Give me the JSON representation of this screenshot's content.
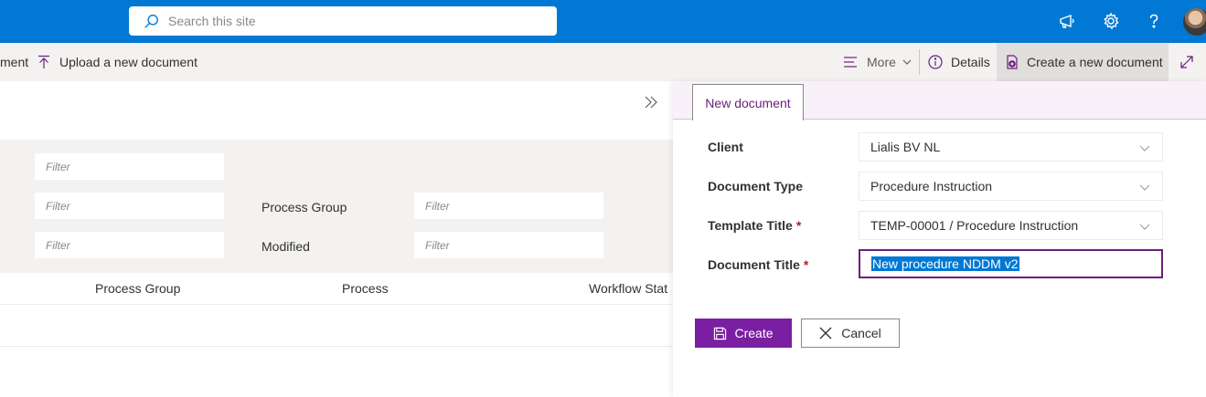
{
  "search": {
    "placeholder": "Search this site"
  },
  "suite_icons": [
    "megaphone-icon",
    "gear-icon",
    "help-icon"
  ],
  "commandbar": {
    "partial_left": "ment",
    "upload_label": "Upload a new document",
    "more_label": "More",
    "details_label": "Details",
    "create_label": "Create a new document"
  },
  "filters": {
    "placeholder": "Filter",
    "labels": [
      "Process Group",
      "Modified"
    ]
  },
  "grid": {
    "columns": [
      "Process Group",
      "Process",
      "Workflow Stat"
    ]
  },
  "panel": {
    "tab_label": "New document",
    "fields": [
      {
        "label": "Client",
        "value": "Lialis BV NL",
        "required": false
      },
      {
        "label": "Document Type",
        "value": "Procedure Instruction",
        "required": false
      },
      {
        "label": "Template Title",
        "value": "TEMP-00001 / Procedure Instruction",
        "required": true
      }
    ],
    "title_field": {
      "label": "Document Title",
      "value": "New procedure NDDM v2",
      "required": true
    },
    "required_mark": "*",
    "create_button": "Create",
    "cancel_button": "Cancel"
  },
  "colors": {
    "suitebar": "#0078d4",
    "accent": "#7b1fa2",
    "required": "#a4262c"
  }
}
